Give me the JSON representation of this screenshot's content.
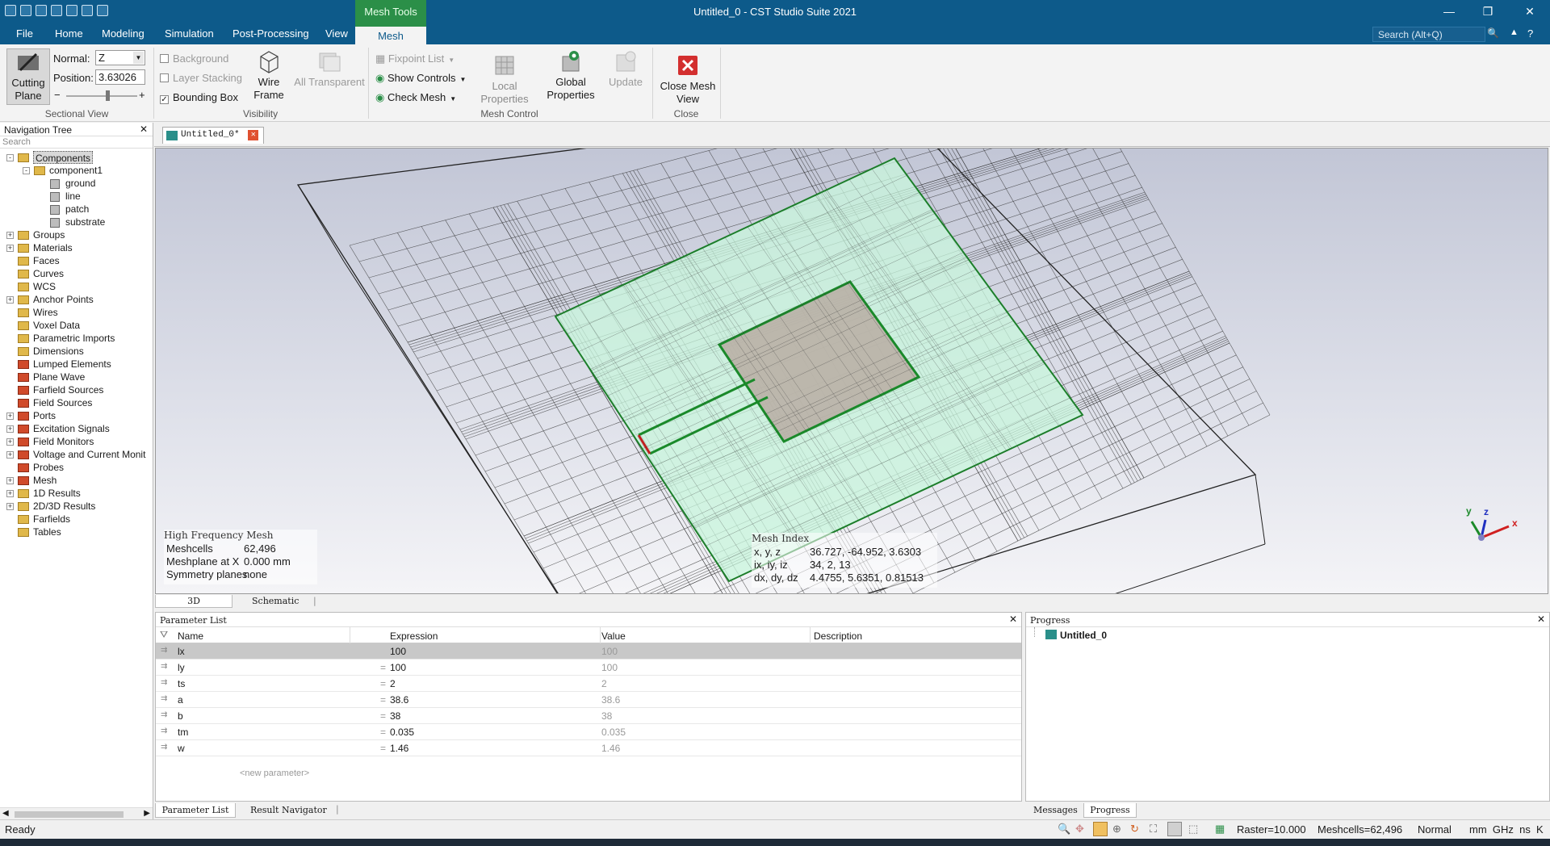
{
  "window": {
    "title": "Untitled_0 - CST Studio Suite 2021",
    "context_tab": "Mesh Tools"
  },
  "menu": {
    "file": "File",
    "home": "Home",
    "modeling": "Modeling",
    "simulation": "Simulation",
    "post": "Post-Processing",
    "view": "View",
    "mesh": "Mesh",
    "search": "Search (Alt+Q)"
  },
  "ribbon": {
    "cutting_plane_1": "Cutting",
    "cutting_plane_2": "Plane",
    "normal_label": "Normal:",
    "normal_value": "Z",
    "position_label": "Position:",
    "position_value": "3.63026",
    "slider_minus": "−",
    "slider_plus": "+",
    "sectional_view": "Sectional View",
    "background": "Background",
    "layer_stacking": "Layer Stacking",
    "bounding_box": "Bounding Box",
    "wire_frame_1": "Wire",
    "wire_frame_2": "Frame",
    "all_transparent": "All Transparent",
    "visibility": "Visibility",
    "fixpoint_list": "Fixpoint List",
    "show_controls": "Show Controls",
    "check_mesh": "Check Mesh",
    "local_props_1": "Local",
    "local_props_2": "Properties",
    "global_props_1": "Global",
    "global_props_2": "Properties",
    "update": "Update",
    "mesh_control": "Mesh Control",
    "close_mesh_1": "Close Mesh",
    "close_mesh_2": "View",
    "close": "Close"
  },
  "nav": {
    "title": "Navigation Tree",
    "search": "Search",
    "items": [
      "Components",
      "component1",
      "ground",
      "line",
      "patch",
      "substrate",
      "Groups",
      "Materials",
      "Faces",
      "Curves",
      "WCS",
      "Anchor Points",
      "Wires",
      "Voxel Data",
      "Parametric Imports",
      "Dimensions",
      "Lumped Elements",
      "Plane Wave",
      "Farfield Sources",
      "Field Sources",
      "Ports",
      "Excitation Signals",
      "Field Monitors",
      "Voltage and Current Monit",
      "Probes",
      "Mesh",
      "1D Results",
      "2D/3D Results",
      "Farfields",
      "Tables"
    ]
  },
  "doc_tab": "Untitled_0*",
  "view": {
    "hf_title": "High Frequency Mesh",
    "meshcells_label": "Meshcells",
    "meshcells_value": "62,496",
    "meshplane_label": "Meshplane at X",
    "meshplane_value": "0.000 mm",
    "sym_label": "Symmetry planes",
    "sym_value": "none",
    "mi_title": "Mesh Index",
    "xyz_label": "x, y, z",
    "xyz_value": "36.727, -64.952, 3.6303",
    "ixyz_label": "ix, iy, iz",
    "ixyz_value": "34, 2, 13",
    "dxyz_label": "dx, dy, dz",
    "dxyz_value": "4.4755, 5.6351, 0.81513",
    "axis_x": "x",
    "axis_y": "y",
    "axis_z": "z"
  },
  "view_tabs": {
    "t3d": "3D",
    "schematic": "Schematic"
  },
  "params": {
    "title": "Parameter List",
    "headers": [
      "Name",
      "Expression",
      "Value",
      "Description"
    ],
    "rows": [
      {
        "name": "lx",
        "expr": "100",
        "value": "100"
      },
      {
        "name": "ly",
        "expr": "100",
        "value": "100"
      },
      {
        "name": "ts",
        "expr": "2",
        "value": "2"
      },
      {
        "name": "a",
        "expr": "38.6",
        "value": "38.6"
      },
      {
        "name": "b",
        "expr": "38",
        "value": "38"
      },
      {
        "name": "tm",
        "expr": "0.035",
        "value": "0.035"
      },
      {
        "name": "w",
        "expr": "1.46",
        "value": "1.46"
      }
    ],
    "new_param": "<new parameter>",
    "eq": "="
  },
  "progress": {
    "title": "Progress",
    "item": "Untitled_0"
  },
  "bottom_tabs": {
    "plist": "Parameter List",
    "result_nav": "Result Navigator",
    "messages": "Messages",
    "progress": "Progress"
  },
  "status": {
    "ready": "Ready",
    "raster": "Raster=10.000",
    "meshcells": "Meshcells=62,496",
    "mode": "Normal",
    "units": "mm  GHz  ns  K"
  },
  "colors": {
    "accent": "#0d5a8a",
    "context": "#2b8f48",
    "substrate": "#c8f5dc",
    "patch": "#b8ada3",
    "line_green": "#1a8a2a"
  }
}
